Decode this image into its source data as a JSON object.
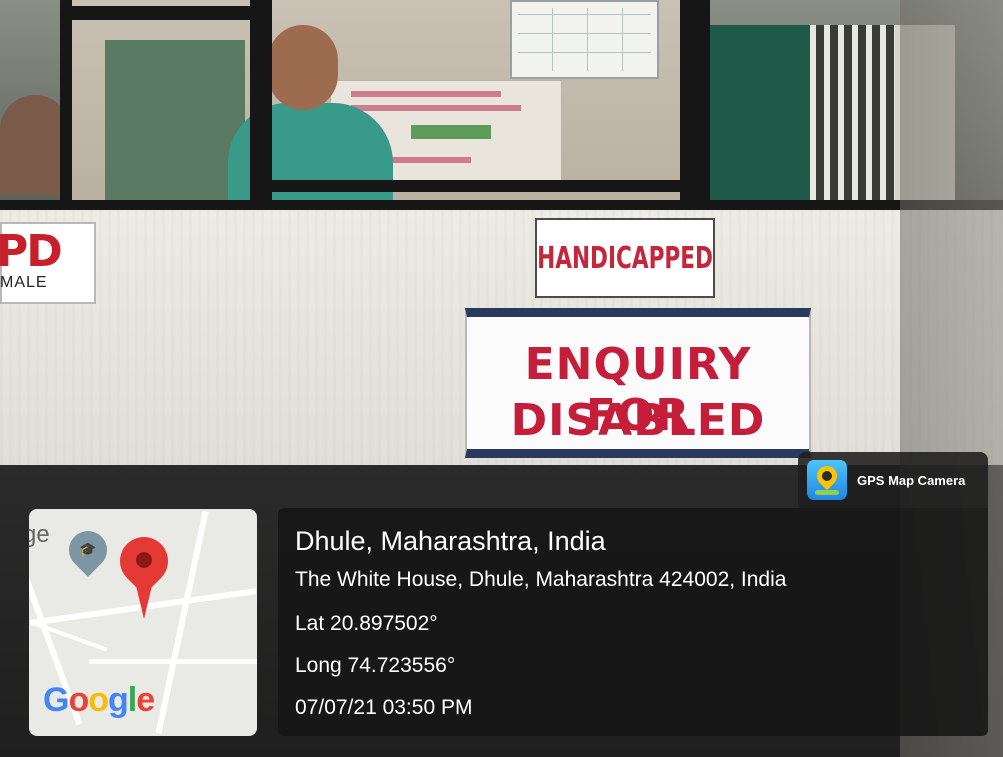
{
  "signs": {
    "opd": {
      "main": "PD",
      "sub": "MALE"
    },
    "handicapped": "HANDICAPPED",
    "enquiry": {
      "line1": "ENQUIRY FOR",
      "line2": "DISABLED"
    }
  },
  "gps_overlay": {
    "app_name": "GPS Map Camera",
    "city": "Dhule, Maharashtra, India",
    "address": "The White House, Dhule, Maharashtra 424002, India",
    "latitude": "Lat 20.897502°",
    "longitude": "Long 74.723556°",
    "timestamp": "07/07/21 03:50 PM",
    "map": {
      "label_fragment": "ge",
      "google": [
        "G",
        "o",
        "o",
        "g",
        "l",
        "e"
      ]
    }
  },
  "colors": {
    "sign_red": "#c41e3a",
    "sign_navy": "#2a3a5c",
    "overlay_bg": "#161616",
    "pin_red": "#e53935"
  },
  "icons": [
    "graduation-cap-pin-icon",
    "location-pin-icon",
    "gps-map-camera-logo-icon"
  ]
}
